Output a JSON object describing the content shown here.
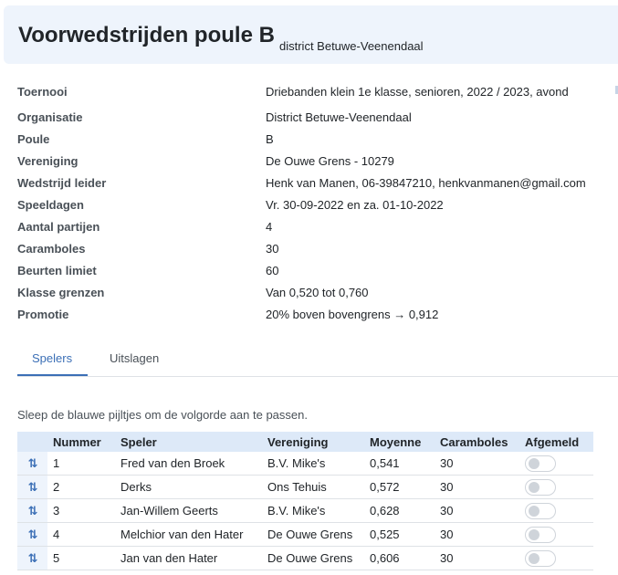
{
  "header": {
    "title": "Voorwedstrijden poule B",
    "subtitle": "district Betuwe-Veenendaal"
  },
  "info": [
    {
      "label": "Toernooi",
      "value": "Driebanden klein 1e klasse, senioren, 2022 / 2023, avond"
    },
    {
      "label": "Organisatie",
      "value": "District Betuwe-Veenendaal"
    },
    {
      "label": "Poule",
      "value": "B"
    },
    {
      "label": "Vereniging",
      "value": "De Ouwe Grens - 10279"
    },
    {
      "label": "Wedstrijd leider",
      "value": "Henk van Manen, 06-39847210, henkvanmanen@gmail.com"
    },
    {
      "label": "Speeldagen",
      "value": "Vr. 30-09-2022 en za. 01-10-2022"
    },
    {
      "label": "Aantal partijen",
      "value": "4"
    },
    {
      "label": "Caramboles",
      "value": "30"
    },
    {
      "label": "Beurten limiet",
      "value": "60"
    },
    {
      "label": "Klasse grenzen",
      "value": "Van 0,520 tot 0,760"
    },
    {
      "label": "Promotie",
      "value": "20% boven bovengrens → 0,912"
    }
  ],
  "tabs": [
    {
      "label": "Spelers",
      "active": true
    },
    {
      "label": "Uitslagen",
      "active": false
    }
  ],
  "hint": "Sleep de blauwe pijltjes om de volgorde aan te passen.",
  "table": {
    "columns": [
      "Nummer",
      "Speler",
      "Vereniging",
      "Moyenne",
      "Caramboles",
      "Afgemeld"
    ],
    "rows": [
      {
        "nummer": "1",
        "speler": "Fred van den Broek",
        "vereniging": "B.V. Mike's",
        "moyenne": "0,541",
        "caramboles": "30",
        "afgemeld": false
      },
      {
        "nummer": "2",
        "speler": "Derks",
        "vereniging": "Ons Tehuis",
        "moyenne": "0,572",
        "caramboles": "30",
        "afgemeld": false
      },
      {
        "nummer": "3",
        "speler": "Jan-Willem Geerts",
        "vereniging": "B.V. Mike's",
        "moyenne": "0,628",
        "caramboles": "30",
        "afgemeld": false
      },
      {
        "nummer": "4",
        "speler": "Melchior van den Hater",
        "vereniging": "De Ouwe Grens",
        "moyenne": "0,525",
        "caramboles": "30",
        "afgemeld": false
      },
      {
        "nummer": "5",
        "speler": "Jan van den Hater",
        "vereniging": "De Ouwe Grens",
        "moyenne": "0,606",
        "caramboles": "30",
        "afgemeld": false
      }
    ]
  },
  "icons": {
    "drag_handle": "sort-arrows-icon",
    "drag_glyph": "⇅"
  },
  "colors": {
    "accent": "#3b6fb6",
    "header_bg": "#eef4fc",
    "table_header_bg": "#dde9f8"
  }
}
